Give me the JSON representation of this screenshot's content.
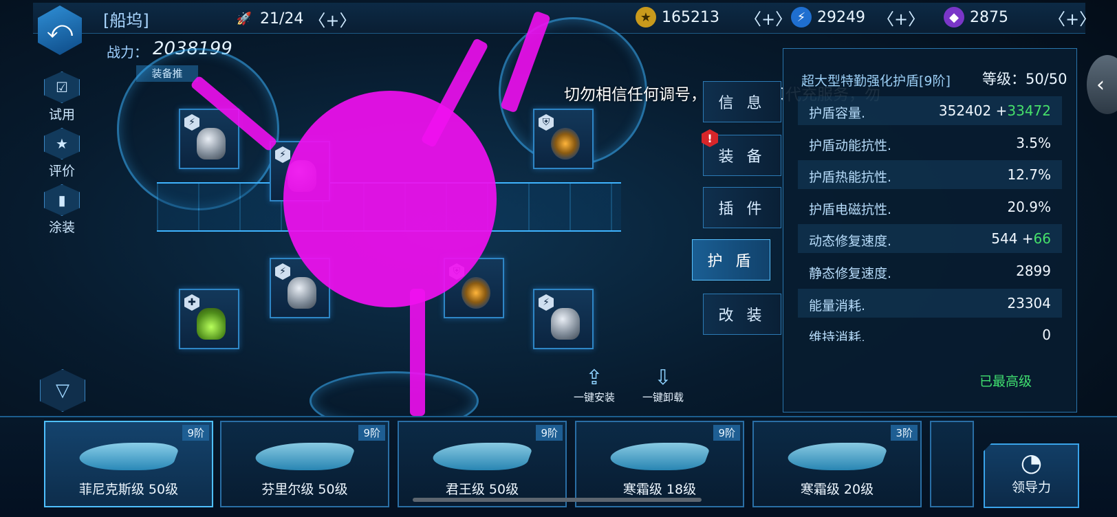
{
  "header": {
    "title": "[船坞]",
    "ship_count": "21/24",
    "credits": "165213",
    "energy": "29249",
    "crystals": "2875",
    "plus": "+"
  },
  "power": {
    "label": "战力：",
    "value": "2038199"
  },
  "recommend_tag": "装备推",
  "side_menu": [
    {
      "label": "试用",
      "icon": "checkbox-icon"
    },
    {
      "label": "评价",
      "icon": "star-doc-icon"
    },
    {
      "label": "涂装",
      "icon": "spray-can-icon"
    }
  ],
  "notice": "切勿相信任何调号，借号，折扣代充服务，勿",
  "actions": {
    "install_all": "一键安装",
    "uninstall_all": "一键卸载"
  },
  "tabs": [
    "信 息",
    "装 备",
    "插 件",
    "护 盾",
    "改 装"
  ],
  "active_tab": "护 盾",
  "panel": {
    "title": "超大型特勤强化护盾[9阶]",
    "level_label": "等级：",
    "level": "50/50",
    "stats": [
      {
        "name": "护盾容量.",
        "value": "352402 +",
        "bonus": "33472"
      },
      {
        "name": "护盾动能抗性.",
        "value": "3.5%",
        "bonus": ""
      },
      {
        "name": "护盾热能抗性.",
        "value": "12.7%",
        "bonus": ""
      },
      {
        "name": "护盾电磁抗性.",
        "value": "20.9%",
        "bonus": ""
      },
      {
        "name": "动态修复速度.",
        "value": "544 +",
        "bonus": "66"
      },
      {
        "name": "静态修复速度.",
        "value": "2899",
        "bonus": ""
      },
      {
        "name": "能量消耗.",
        "value": "23304",
        "bonus": ""
      },
      {
        "name": "维持消耗.",
        "value": "0",
        "bonus": ""
      }
    ],
    "status": "已最高级"
  },
  "ships": [
    {
      "name": "菲尼克斯级 50级",
      "tier": "9阶"
    },
    {
      "name": "芬里尔级 50级",
      "tier": "9阶"
    },
    {
      "name": "君王级 50级",
      "tier": "9阶"
    },
    {
      "name": "寒霜级 18级",
      "tier": "9阶"
    },
    {
      "name": "寒霜级 20级",
      "tier": "3阶"
    }
  ],
  "leadership": "领导力",
  "colors": {
    "accent": "#3fb4ff",
    "bonus_green": "#46e06a",
    "maxed_green": "#40e070",
    "magenta": "#f010ef",
    "alert_red": "#d8262a"
  }
}
